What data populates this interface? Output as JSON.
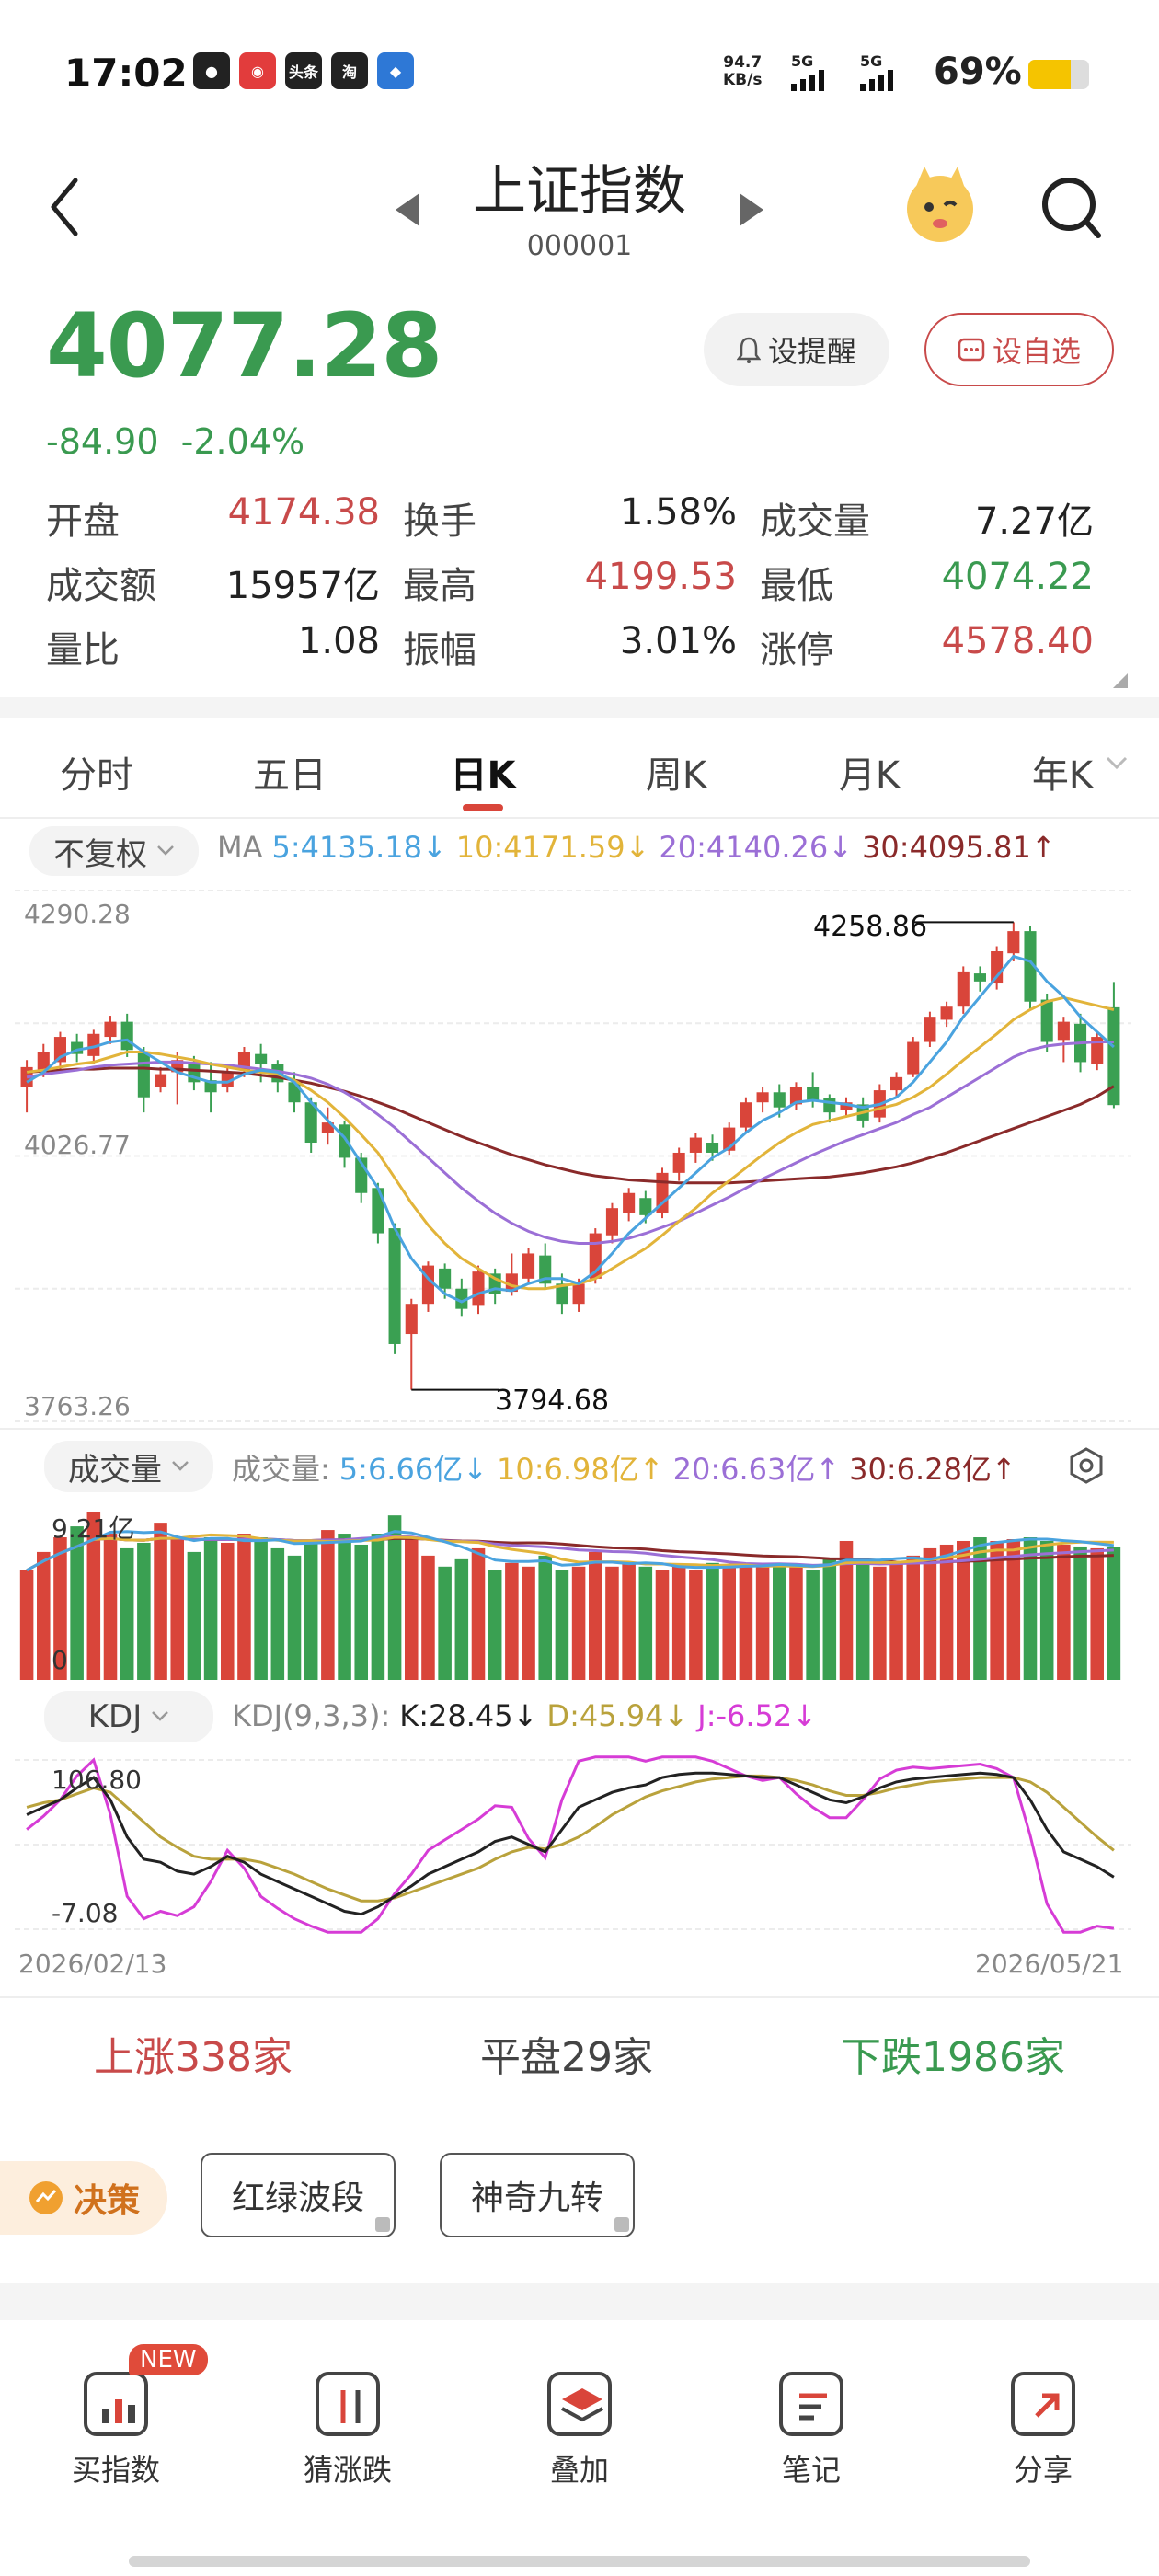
{
  "status_bar": {
    "time": "17:02",
    "app_icons": [
      {
        "name": "wechat-icon",
        "glyph": "●",
        "color": "#222222"
      },
      {
        "name": "netease-icon",
        "glyph": "◉",
        "color": "#e23c3c"
      },
      {
        "name": "toutiao-icon",
        "glyph": "头条",
        "color": "#222222"
      },
      {
        "name": "taobao-icon",
        "glyph": "淘",
        "color": "#222222"
      },
      {
        "name": "finance-app-icon",
        "glyph": "◆",
        "color": "#2e78d6"
      }
    ],
    "net_speed_value": "94.7",
    "net_speed_unit": "KB/s",
    "signal_labels": [
      "5G",
      "5G"
    ],
    "battery_percent": "69%",
    "battery_level": 0.69
  },
  "header": {
    "back_icon": "chevron-left-icon",
    "title": "上证指数",
    "code": "000001",
    "prev_icon": "triangle-left-icon",
    "next_icon": "triangle-right-icon",
    "mascot_icon": "mascot-icon",
    "search_icon": "search-icon"
  },
  "quote": {
    "price": "4077.28",
    "change_points": "-84.90",
    "change_percent": "-2.04%",
    "alert_label": "设提醒",
    "watch_label": "设自选"
  },
  "stats": [
    [
      {
        "label": "开盘",
        "value": "4174.38",
        "tone": "red"
      },
      {
        "label": "换手",
        "value": "1.58%",
        "tone": "dark"
      },
      {
        "label": "成交量",
        "value": "7.27亿",
        "tone": "dark"
      }
    ],
    [
      {
        "label": "成交额",
        "value": "15957亿",
        "tone": "dark"
      },
      {
        "label": "最高",
        "value": "4199.53",
        "tone": "red"
      },
      {
        "label": "最低",
        "value": "4074.22",
        "tone": "green"
      }
    ],
    [
      {
        "label": "量比",
        "value": "1.08",
        "tone": "dark"
      },
      {
        "label": "振幅",
        "value": "3.01%",
        "tone": "dark"
      },
      {
        "label": "涨停",
        "value": "4578.40",
        "tone": "red"
      }
    ]
  ],
  "period_tabs": [
    "分时",
    "五日",
    "日K",
    "周K",
    "月K",
    "年K"
  ],
  "active_tab": "日K",
  "indicators": {
    "adjust_label": "不复权",
    "ma_prefix": "MA",
    "ma": [
      {
        "text": "5:4135.18↓",
        "color": "#4aa3df"
      },
      {
        "text": "10:4171.59↓",
        "color": "#e2b43a"
      },
      {
        "text": "20:4140.26↓",
        "color": "#9b6fd6"
      },
      {
        "text": "30:4095.81↑",
        "color": "#8a2a2a"
      }
    ],
    "volume_label": "成交量",
    "volume_prefix": "成交量:",
    "vol_ma": [
      {
        "text": "5:6.66亿↓",
        "color": "#4aa3df"
      },
      {
        "text": "10:6.98亿↑",
        "color": "#e2b43a"
      },
      {
        "text": "20:6.63亿↑",
        "color": "#9b6fd6"
      },
      {
        "text": "30:6.28亿↑",
        "color": "#8a2a2a"
      }
    ],
    "kdj_label": "KDJ",
    "kdj_prefix": "KDJ(9,3,3):",
    "kdj_values": [
      {
        "text": "K:28.45↓",
        "color": "#222222"
      },
      {
        "text": "D:45.94↓",
        "color": "#b9a23c"
      },
      {
        "text": "J:-6.52↓",
        "color": "#d63cd6"
      }
    ]
  },
  "chart_data": {
    "type": "candlestick",
    "y_max_label": "4290.28",
    "y_mid_label": "4026.77",
    "y_min_label": "3763.26",
    "ylim": [
      3763.26,
      4290.28
    ],
    "high_annotation": "4258.86",
    "low_annotation": "3794.68",
    "volume_top_label": "9.21亿",
    "volume_bottom_label": "0",
    "kdj_top_label": "106.80",
    "kdj_bottom_label": "-7.08",
    "kdj_ylim": [
      -7.08,
      106.8
    ],
    "date_start": "2026/02/13",
    "date_end": "2026/05/21",
    "candles": [
      [
        4095,
        4115,
        4070,
        4122
      ],
      [
        4112,
        4130,
        4105,
        4138
      ],
      [
        4120,
        4145,
        4112,
        4150
      ],
      [
        4140,
        4128,
        4120,
        4148
      ],
      [
        4126,
        4148,
        4118,
        4152
      ],
      [
        4145,
        4160,
        4138,
        4166
      ],
      [
        4160,
        4132,
        4125,
        4168
      ],
      [
        4130,
        4085,
        4070,
        4135
      ],
      [
        4095,
        4108,
        4090,
        4115
      ],
      [
        4110,
        4122,
        4078,
        4130
      ],
      [
        4120,
        4100,
        4092,
        4126
      ],
      [
        4102,
        4090,
        4070,
        4120
      ],
      [
        4095,
        4110,
        4090,
        4115
      ],
      [
        4112,
        4130,
        4105,
        4135
      ],
      [
        4128,
        4118,
        4100,
        4138
      ],
      [
        4118,
        4100,
        4090,
        4122
      ],
      [
        4100,
        4080,
        4070,
        4110
      ],
      [
        4080,
        4040,
        4030,
        4085
      ],
      [
        4050,
        4060,
        4038,
        4075
      ],
      [
        4058,
        4025,
        4015,
        4062
      ],
      [
        4025,
        3990,
        3980,
        4030
      ],
      [
        3995,
        3950,
        3940,
        4000
      ],
      [
        3955,
        3840,
        3830,
        3960
      ],
      [
        3850,
        3880,
        3794.68,
        3885
      ],
      [
        3880,
        3918,
        3872,
        3922
      ],
      [
        3915,
        3895,
        3885,
        3920
      ],
      [
        3895,
        3875,
        3868,
        3905
      ],
      [
        3878,
        3912,
        3870,
        3918
      ],
      [
        3910,
        3890,
        3880,
        3915
      ],
      [
        3892,
        3910,
        3888,
        3930
      ],
      [
        3905,
        3930,
        3900,
        3935
      ],
      [
        3928,
        3900,
        3895,
        3940
      ],
      [
        3900,
        3880,
        3870,
        3910
      ],
      [
        3880,
        3900,
        3872,
        3905
      ],
      [
        3905,
        3950,
        3900,
        3955
      ],
      [
        3948,
        3975,
        3940,
        3980
      ],
      [
        3970,
        3990,
        3962,
        3995
      ],
      [
        3985,
        3968,
        3960,
        3992
      ],
      [
        3970,
        4010,
        3965,
        4015
      ],
      [
        4010,
        4030,
        4002,
        4035
      ],
      [
        4030,
        4045,
        4020,
        4050
      ],
      [
        4040,
        4030,
        4022,
        4048
      ],
      [
        4032,
        4055,
        4028,
        4060
      ],
      [
        4055,
        4080,
        4050,
        4085
      ],
      [
        4080,
        4090,
        4070,
        4095
      ],
      [
        4090,
        4075,
        4065,
        4098
      ],
      [
        4078,
        4095,
        4072,
        4100
      ],
      [
        4095,
        4082,
        4075,
        4110
      ],
      [
        4084,
        4070,
        4060,
        4088
      ],
      [
        4072,
        4080,
        4065,
        4085
      ],
      [
        4078,
        4062,
        4055,
        4085
      ],
      [
        4065,
        4092,
        4060,
        4098
      ],
      [
        4092,
        4105,
        4085,
        4110
      ],
      [
        4108,
        4140,
        4105,
        4145
      ],
      [
        4140,
        4165,
        4135,
        4170
      ],
      [
        4162,
        4175,
        4155,
        4180
      ],
      [
        4175,
        4210,
        4168,
        4215
      ],
      [
        4208,
        4200,
        4190,
        4215
      ],
      [
        4198,
        4230,
        4192,
        4235
      ],
      [
        4228,
        4250,
        4220,
        4258.86
      ],
      [
        4250,
        4180,
        4172,
        4255
      ],
      [
        4182,
        4140,
        4130,
        4188
      ],
      [
        4142,
        4160,
        4120,
        4165
      ],
      [
        4158,
        4120,
        4110,
        4168
      ],
      [
        4118,
        4145,
        4112,
        4150
      ],
      [
        4174.38,
        4077.28,
        4074.22,
        4199.53
      ]
    ],
    "ma5": [
      4100,
      4110,
      4125,
      4132,
      4135,
      4140,
      4142,
      4130,
      4120,
      4110,
      4105,
      4100,
      4100,
      4108,
      4112,
      4110,
      4100,
      4080,
      4062,
      4045,
      4020,
      3995,
      3955,
      3925,
      3905,
      3890,
      3882,
      3890,
      3895,
      3893,
      3900,
      3905,
      3905,
      3900,
      3912,
      3930,
      3950,
      3965,
      3980,
      3995,
      4010,
      4025,
      4035,
      4050,
      4062,
      4070,
      4080,
      4082,
      4080,
      4078,
      4075,
      4078,
      4085,
      4100,
      4120,
      4140,
      4165,
      4185,
      4205,
      4225,
      4220,
      4200,
      4185,
      4165,
      4150,
      4135
    ],
    "ma10": [
      4110,
      4112,
      4115,
      4118,
      4120,
      4125,
      4130,
      4130,
      4128,
      4125,
      4122,
      4118,
      4115,
      4112,
      4110,
      4108,
      4102,
      4092,
      4080,
      4065,
      4048,
      4030,
      4005,
      3980,
      3958,
      3940,
      3925,
      3915,
      3905,
      3898,
      3895,
      3895,
      3898,
      3900,
      3905,
      3915,
      3925,
      3935,
      3948,
      3962,
      3975,
      3990,
      4002,
      4015,
      4028,
      4040,
      4050,
      4058,
      4062,
      4066,
      4070,
      4074,
      4078,
      4085,
      4095,
      4108,
      4122,
      4135,
      4148,
      4162,
      4172,
      4180,
      4184,
      4180,
      4176,
      4172
    ],
    "ma20": [
      4105,
      4108,
      4110,
      4112,
      4115,
      4117,
      4118,
      4119,
      4120,
      4120,
      4119,
      4118,
      4117,
      4115,
      4113,
      4111,
      4108,
      4104,
      4098,
      4090,
      4080,
      4068,
      4055,
      4040,
      4025,
      4010,
      3995,
      3982,
      3970,
      3960,
      3952,
      3946,
      3942,
      3940,
      3940,
      3942,
      3945,
      3950,
      3956,
      3962,
      3970,
      3978,
      3986,
      3995,
      4004,
      4012,
      4020,
      4028,
      4035,
      4042,
      4048,
      4054,
      4060,
      4068,
      4075,
      4085,
      4095,
      4105,
      4115,
      4125,
      4132,
      4136,
      4138,
      4139,
      4140,
      4140
    ],
    "ma30": [
      4110,
      4111,
      4112,
      4113,
      4113,
      4114,
      4114,
      4114,
      4113,
      4113,
      4112,
      4111,
      4110,
      4109,
      4107,
      4105,
      4102,
      4099,
      4095,
      4091,
      4086,
      4080,
      4074,
      4067,
      4060,
      4053,
      4046,
      4040,
      4034,
      4028,
      4023,
      4018,
      4014,
      4010,
      4007,
      4005,
      4003,
      4002,
      4001,
      4000,
      4000,
      4000,
      4000,
      4001,
      4002,
      4003,
      4004,
      4005,
      4006,
      4008,
      4010,
      4013,
      4016,
      4020,
      4025,
      4030,
      4036,
      4042,
      4048,
      4054,
      4060,
      4066,
      4072,
      4078,
      4086,
      4096
    ],
    "volumes": [
      6.0,
      7.0,
      7.8,
      8.4,
      9.2,
      8.0,
      7.2,
      7.5,
      8.6,
      7.8,
      7.0,
      7.8,
      7.5,
      8.0,
      7.8,
      7.2,
      6.8,
      7.6,
      8.2,
      8.0,
      7.4,
      8.0,
      9.0,
      7.8,
      6.8,
      6.2,
      6.6,
      7.2,
      6.0,
      6.4,
      6.2,
      6.8,
      6.0,
      6.2,
      7.0,
      6.2,
      6.4,
      6.2,
      6.0,
      6.2,
      6.0,
      6.4,
      6.3,
      6.2,
      6.3,
      6.4,
      6.2,
      6.0,
      6.6,
      7.6,
      6.4,
      6.2,
      6.4,
      6.8,
      7.2,
      7.4,
      7.6,
      7.8,
      7.6,
      7.7,
      7.8,
      7.6,
      7.4,
      7.3,
      7.2,
      7.27
    ],
    "kdj_k": [
      70,
      75,
      80,
      88,
      95,
      80,
      55,
      40,
      38,
      32,
      30,
      35,
      42,
      38,
      30,
      25,
      20,
      15,
      10,
      5,
      3,
      8,
      15,
      22,
      30,
      35,
      40,
      45,
      52,
      55,
      50,
      45,
      60,
      75,
      80,
      85,
      88,
      90,
      95,
      97,
      98,
      98,
      97,
      96,
      95,
      95,
      90,
      85,
      80,
      78,
      82,
      88,
      92,
      94,
      95,
      96,
      97,
      98,
      97,
      95,
      80,
      60,
      45,
      40,
      35,
      28
    ],
    "kdj_d": [
      75,
      78,
      80,
      84,
      88,
      85,
      75,
      65,
      55,
      48,
      42,
      40,
      40,
      40,
      38,
      34,
      30,
      25,
      20,
      16,
      12,
      12,
      14,
      18,
      22,
      26,
      30,
      34,
      40,
      45,
      48,
      47,
      50,
      55,
      62,
      70,
      76,
      82,
      86,
      89,
      92,
      94,
      95,
      96,
      96,
      95,
      93,
      90,
      86,
      83,
      83,
      85,
      88,
      90,
      92,
      93,
      94,
      95,
      95,
      95,
      92,
      85,
      75,
      65,
      55,
      45.94
    ],
    "kdj_j": [
      60,
      69,
      80,
      96,
      106.8,
      70,
      15,
      0,
      5,
      2,
      8,
      25,
      46,
      34,
      15,
      7,
      0,
      -5,
      -10,
      -17,
      -15,
      0,
      17,
      30,
      46,
      53,
      60,
      67,
      76,
      75,
      54,
      41,
      80,
      106,
      116,
      115,
      112,
      106,
      113,
      113,
      110,
      106,
      101,
      96,
      93,
      95,
      84,
      75,
      68,
      68,
      80,
      94,
      100,
      102,
      101,
      102,
      103,
      104,
      101,
      95,
      56,
      10,
      -15,
      -10,
      -5,
      -6.52
    ]
  },
  "market_breadth": {
    "up_label": "上涨",
    "up_count": "338",
    "unit": "家",
    "flat_label": "平盘",
    "flat_count": "29",
    "down_label": "下跌",
    "down_count": "1986"
  },
  "tools": {
    "decision_label": "决策",
    "chips": [
      "红绿波段",
      "神奇九转"
    ]
  },
  "bottom_nav": [
    {
      "label": "买指数",
      "icon": "bar-chart-icon",
      "badge": "NEW"
    },
    {
      "label": "猜涨跌",
      "icon": "up-down-icon"
    },
    {
      "label": "叠加",
      "icon": "layers-icon"
    },
    {
      "label": "笔记",
      "icon": "note-icon"
    },
    {
      "label": "分享",
      "icon": "share-icon"
    }
  ],
  "colors": {
    "up": "#d9453a",
    "down": "#3aa052",
    "accent": "#d9453a"
  }
}
